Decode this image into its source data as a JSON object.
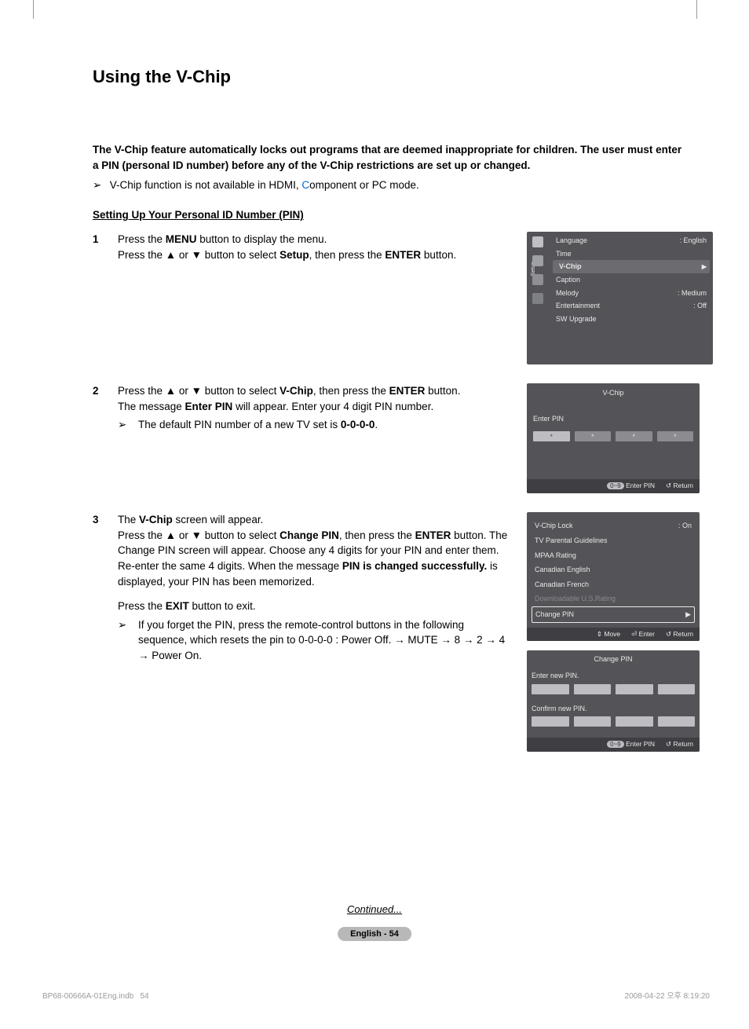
{
  "title": "Using the V-Chip",
  "intro": "The V-Chip feature automatically locks out programs that are deemed inappropriate for children. The user must enter a PIN (personal ID number) before any of the V-Chip restrictions are set up or changed.",
  "note_prefix": "V-Chip function is not available in HDMI, ",
  "note_comp": "C",
  "note_suffix": "omponent or PC mode.",
  "section_sub": "Setting Up Your Personal ID Number (PIN)",
  "steps": {
    "s1": {
      "num": "1",
      "line1a": "Press the ",
      "line1b_bold": "MENU",
      "line1c": " button to display the menu.",
      "line2a": "Press the ▲ or ▼ button to select ",
      "line2b_bold": "Setup",
      "line2c": ", then press the ",
      "line2d_bold": "ENTER",
      "line2e": " button."
    },
    "s2": {
      "num": "2",
      "line1a": "Press the ▲ or ▼ button to select ",
      "line1b_bold": "V-Chip",
      "line1c": ", then press the ",
      "line1d_bold": "ENTER",
      "line1e": " button.",
      "line2a": "The message ",
      "line2b_bold": "Enter PIN",
      "line2c": " will appear. Enter your 4 digit PIN number.",
      "sub_a": "The default PIN number of a new TV set is ",
      "sub_b_bold": "0-0-0-0",
      "sub_c": "."
    },
    "s3": {
      "num": "3",
      "line1a": "The ",
      "line1b_bold": "V-Chip",
      "line1c": " screen will appear.",
      "line2a": "Press the ▲ or ▼ button to select ",
      "line2b_bold": "Change PIN",
      "line2c": ", then press the ",
      "line2d_bold": "ENTER",
      "line2e": " button. The Change PIN screen will appear. Choose any 4 digits for your PIN and enter them. Re-enter the same 4 digits. When the message ",
      "line2f_bold": "PIN is changed successfully.",
      "line2g": " is displayed, your PIN has been memorized.",
      "line3a": "Press the ",
      "line3b_bold": "EXIT",
      "line3c": " button to exit.",
      "sub": "If you forget the PIN, press the remote-control buttons in the following sequence, which resets the pin to 0-0-0-0 : Power Off. → MUTE → 8 → 2 → 4 → Power On."
    }
  },
  "osd1": {
    "side": "Setup",
    "items": [
      {
        "lbl": "Language",
        "val": ": English"
      },
      {
        "lbl": "Time",
        "val": ""
      },
      {
        "lbl": "V-Chip",
        "val": "",
        "sel": true
      },
      {
        "lbl": "Caption",
        "val": ""
      },
      {
        "lbl": "Melody",
        "val": ": Medium"
      },
      {
        "lbl": "Entertainment",
        "val": ": Off"
      },
      {
        "lbl": "SW Upgrade",
        "val": ""
      }
    ]
  },
  "osd2": {
    "title": "V-Chip",
    "label": "Enter PIN",
    "footer_pill": "0~9",
    "footer_a": "Enter PIN",
    "footer_b": "Return"
  },
  "osd3": {
    "items": [
      {
        "lbl": "V-Chip Lock",
        "val": ": On"
      },
      {
        "lbl": "TV Parental Guidelines",
        "val": ""
      },
      {
        "lbl": "MPAA Rating",
        "val": ""
      },
      {
        "lbl": "Canadian English",
        "val": ""
      },
      {
        "lbl": "Canadian French",
        "val": ""
      },
      {
        "lbl": "Downloadable U.S.Rating",
        "val": "",
        "disabled": true
      },
      {
        "lbl": "Change PIN",
        "val": "",
        "sel": true
      }
    ],
    "footer_a": "Move",
    "footer_b": "Enter",
    "footer_c": "Return"
  },
  "osd4": {
    "title": "Change PIN",
    "label1": "Enter new PIN.",
    "label2": "Confirm new PIN.",
    "footer_pill": "0~9",
    "footer_a": "Enter PIN",
    "footer_b": "Return"
  },
  "continued": "Continued...",
  "page_pill": "English - 54",
  "foot_left_a": "BP68-00666A-01Eng.indb",
  "foot_left_b": "54",
  "foot_right": "2008-04-22   오후 8:19:20"
}
